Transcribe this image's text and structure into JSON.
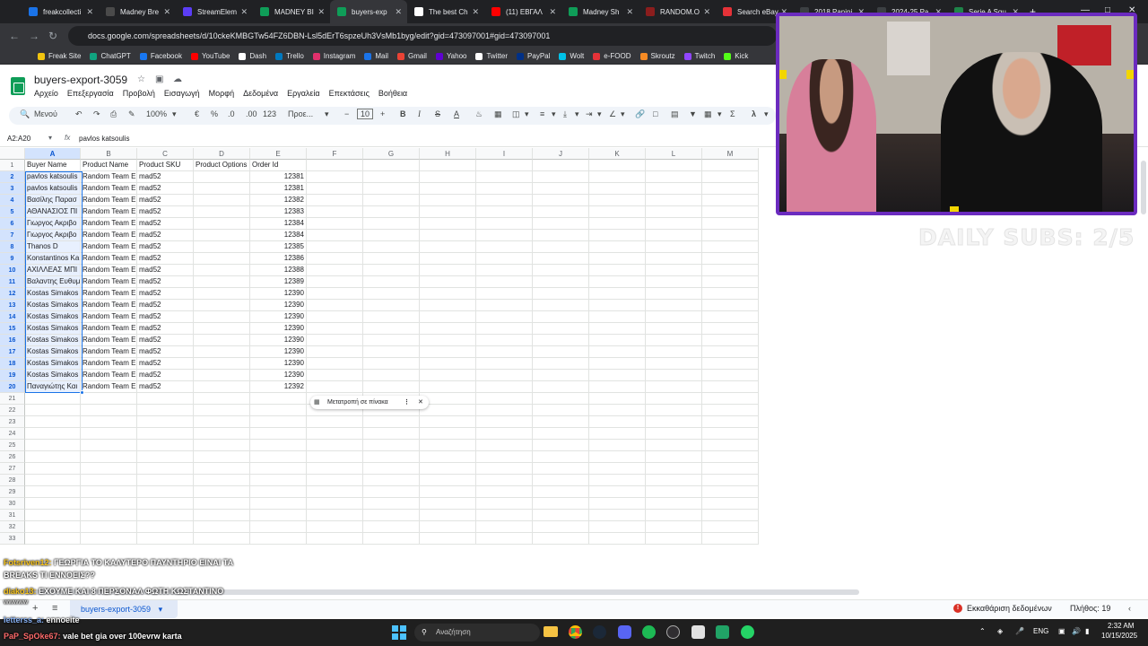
{
  "browser": {
    "tabs": [
      {
        "label": "freakcollecti",
        "color": "#1a73e8"
      },
      {
        "label": "Madney Bre",
        "color": "#4a4a4a"
      },
      {
        "label": "StreamElem",
        "color": "#5b3df5"
      },
      {
        "label": "MADNEY BI",
        "color": "#0f9d58"
      },
      {
        "label": "buyers-exp",
        "color": "#0f9d58"
      },
      {
        "label": "The best Ch",
        "color": "#ffffff"
      },
      {
        "label": "(11) ΕΒΓΑΛ",
        "color": "#ff0000"
      },
      {
        "label": "Madney Sh",
        "color": "#0f9d58"
      },
      {
        "label": "RANDOM.O",
        "color": "#8b1d1d"
      },
      {
        "label": "Search eBay",
        "color": "#e53238"
      },
      {
        "label": "2018 Panini",
        "color": "#3c4043"
      },
      {
        "label": "2024-25 Pa",
        "color": "#3c4043"
      },
      {
        "label": "Serie A Squ",
        "color": "#1e8449"
      }
    ],
    "active_tab_index": 4,
    "url": "docs.google.com/spreadsheets/d/10ckeKMBGTw54FZ6DBN-Lsl5dErT6spzeUh3VsMb1byg/edit?gid=473097001#gid=473097001",
    "bookmarks": [
      {
        "label": "Freak Site",
        "color": "#f1c40f"
      },
      {
        "label": "ChatGPT",
        "color": "#10a37f"
      },
      {
        "label": "Facebook",
        "color": "#1877f2"
      },
      {
        "label": "YouTube",
        "color": "#ff0000"
      },
      {
        "label": "Dash",
        "color": "#ffffff"
      },
      {
        "label": "Trello",
        "color": "#0079bf"
      },
      {
        "label": "Instagram",
        "color": "#e1306c"
      },
      {
        "label": "Mail",
        "color": "#1a73e8"
      },
      {
        "label": "Gmail",
        "color": "#ea4335"
      },
      {
        "label": "Yahoo",
        "color": "#6001d2"
      },
      {
        "label": "Twitter",
        "color": "#ffffff"
      },
      {
        "label": "PayPal",
        "color": "#003087"
      },
      {
        "label": "Wolt",
        "color": "#00c2e8"
      },
      {
        "label": "e-FOOD",
        "color": "#e53238"
      },
      {
        "label": "Skroutz",
        "color": "#f68b24"
      },
      {
        "label": "Twitch",
        "color": "#9146ff"
      },
      {
        "label": "Kick",
        "color": "#53fc18"
      }
    ]
  },
  "sheets": {
    "doc_title": "buyers-export-3059",
    "menus": [
      "Αρχείο",
      "Επεξεργασία",
      "Προβολή",
      "Εισαγωγή",
      "Μορφή",
      "Δεδομένα",
      "Εργαλεία",
      "Επεκτάσεις",
      "Βοήθεια"
    ],
    "toolbar": {
      "search_label": "Μενού",
      "zoom": "100%",
      "currency": "€",
      "percent": "%",
      "dec_less": ".0",
      "dec_more": ".00",
      "num_format": "123",
      "font": "Προε...",
      "font_size": "10",
      "bold": "B",
      "italic": "I",
      "strike": "S",
      "text_color": "A"
    },
    "name_box": "A2:A20",
    "formula_value": "pavlos katsoulis",
    "columns": [
      "A",
      "B",
      "C",
      "D",
      "E",
      "F",
      "G",
      "H",
      "I",
      "J",
      "K",
      "L",
      "M"
    ],
    "header_row": [
      "Buyer Name",
      "Product Name",
      "Product SKU",
      "Product Options",
      "Order Id"
    ],
    "rows": [
      [
        "pavlos katsoulis",
        "Random Team E",
        "mad52",
        "",
        "12381"
      ],
      [
        "pavlos katsoulis",
        "Random Team E",
        "mad52",
        "",
        "12381"
      ],
      [
        "Βασίλης Παρασ",
        "Random Team E",
        "mad52",
        "",
        "12382"
      ],
      [
        "ΑΘΑΝΑΣΙΟΣ ΠΙ",
        "Random Team E",
        "mad52",
        "",
        "12383"
      ],
      [
        "Γιωργος Ακριβο",
        "Random Team E",
        "mad52",
        "",
        "12384"
      ],
      [
        "Γιωργος Ακριβο",
        "Random Team E",
        "mad52",
        "",
        "12384"
      ],
      [
        "Thanos D",
        "Random Team E",
        "mad52",
        "",
        "12385"
      ],
      [
        "Konstantinos Ka",
        "Random Team E",
        "mad52",
        "",
        "12386"
      ],
      [
        "ΑΧΙΛΛΕΑΣ ΜΠΙ",
        "Random Team E",
        "mad52",
        "",
        "12388"
      ],
      [
        "Βαλαντης Ευθυμ",
        "Random Team E",
        "mad52",
        "",
        "12389"
      ],
      [
        "Kostas Simakos",
        "Random Team E",
        "mad52",
        "",
        "12390"
      ],
      [
        "Kostas Simakos",
        "Random Team E",
        "mad52",
        "",
        "12390"
      ],
      [
        "Kostas Simakos",
        "Random Team E",
        "mad52",
        "",
        "12390"
      ],
      [
        "Kostas Simakos",
        "Random Team E",
        "mad52",
        "",
        "12390"
      ],
      [
        "Kostas Simakos",
        "Random Team E",
        "mad52",
        "",
        "12390"
      ],
      [
        "Kostas Simakos",
        "Random Team E",
        "mad52",
        "",
        "12390"
      ],
      [
        "Kostas Simakos",
        "Random Team E",
        "mad52",
        "",
        "12390"
      ],
      [
        "Kostas Simakos",
        "Random Team E",
        "mad52",
        "",
        "12390"
      ],
      [
        "Παναγιώτης Και",
        "Random Team E",
        "mad52",
        "",
        "12392"
      ]
    ],
    "empty_row_numbers": [
      "21",
      "22",
      "23",
      "24",
      "25",
      "26",
      "27",
      "28",
      "29",
      "30",
      "31",
      "32",
      "33"
    ],
    "convert_chip": "Μετατροπή σε πίνακα",
    "sheet_tab": "buyers-export-3059",
    "status_clean": "Εκκαθάριση δεδομένων",
    "status_count": "Πλήθος: 19"
  },
  "overlay": {
    "subs_counter": "DAILY SUBS: 2/5",
    "chat": [
      {
        "user": "Fotsriven12:",
        "text": "ΓΕΩΡΓΙΑ ΤΟ ΚΑΛΥΤΕΡΟ ΠΑΥΝΤΗΡΙΟ ΕΙΝΑΙ ΤΑ"
      },
      {
        "user": "",
        "text": "BREAKS ΤΙ ΕΝΝΟΕΙΣ??"
      },
      {
        "user": "diako13:",
        "text": "ΕΧΟΥΜΕ ΚΑΙ 8 ΠΕΡΣΟΝΑΛ ΦΩΤΗ ΚΩΣΤΑΝΤΙΝΟ"
      },
      {
        "user": "wwwww",
        "text": ""
      },
      {
        "user": "letterss_a:",
        "text": "ennoeite"
      },
      {
        "user": "PaP_SpOke67:",
        "text": "vale bet gia over 100evrw karta"
      }
    ]
  },
  "taskbar": {
    "search_placeholder": "Αναζήτηση",
    "lang": "ENG",
    "time": "2:32 AM",
    "date": "10/15/2025"
  }
}
